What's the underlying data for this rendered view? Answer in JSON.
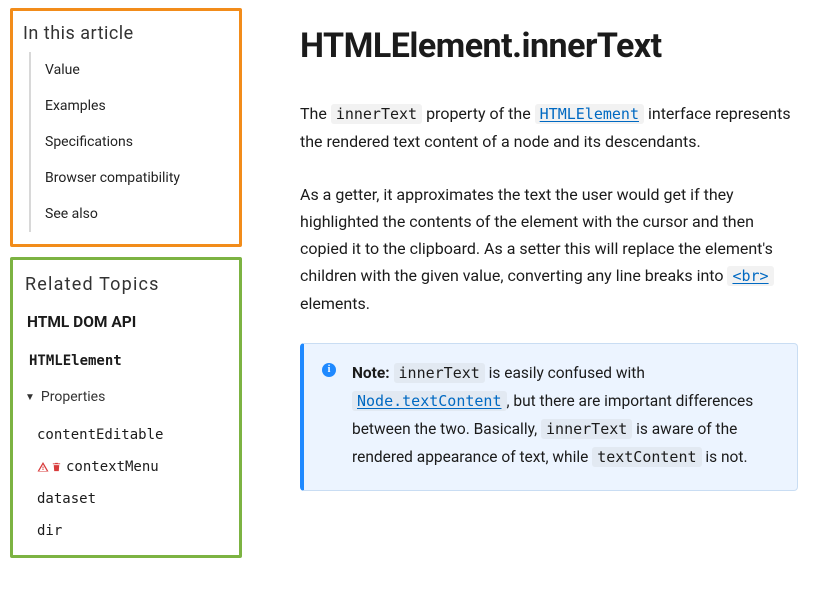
{
  "sidebar": {
    "in_this_article": {
      "heading": "In this article",
      "items": [
        "Value",
        "Examples",
        "Specifications",
        "Browser compatibility",
        "See also"
      ]
    },
    "related": {
      "heading": "Related Topics",
      "api_label": "HTML DOM API",
      "class_name": "HTMLElement",
      "properties_label": "Properties",
      "properties": [
        {
          "name": "contentEditable",
          "deprecated": false
        },
        {
          "name": "contextMenu",
          "deprecated": true
        },
        {
          "name": "dataset",
          "deprecated": false
        },
        {
          "name": "dir",
          "deprecated": false
        }
      ]
    }
  },
  "page": {
    "title": "HTMLElement.innerText",
    "intro": {
      "pre1": "The ",
      "code1": "innerText",
      "mid1": " property of the ",
      "link1_code": "HTMLElement",
      "post1": " interface represents the rendered text content of a node and its descendants."
    },
    "para2": {
      "text1": "As a getter, it approximates the text the user would get if they highlighted the contents of the element with the cursor and then copied it to the clipboard. As a setter this will replace the element's children with the given value, converting any line breaks into ",
      "br_code": "<br>",
      "text2": " elements."
    },
    "note": {
      "label": "Note:",
      "t1": " ",
      "c1": "innerText",
      "t2": " is easily confused with ",
      "link_code": "Node.textContent",
      "t3": ", but there are important differences between the two. Basically, ",
      "c2": "innerText",
      "t4": " is aware of the rendered appearance of text, while ",
      "c3": "textContent",
      "t5": " is not."
    }
  }
}
